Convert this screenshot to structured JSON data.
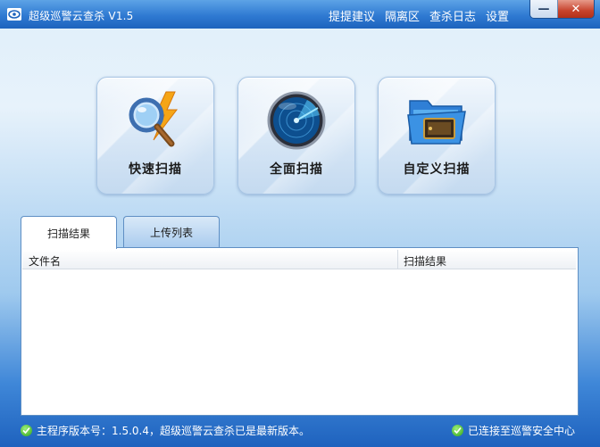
{
  "window": {
    "title": "超级巡警云查杀 V1.5",
    "links": [
      "提提建议",
      "隔离区",
      "查杀日志",
      "设置"
    ],
    "minimize_glyph": "—",
    "close_glyph": "✕"
  },
  "scan_buttons": {
    "quick": {
      "label": "快速扫描",
      "icon": "magnifier-lightning-icon"
    },
    "full": {
      "label": "全面扫描",
      "icon": "radar-icon"
    },
    "custom": {
      "label": "自定义扫描",
      "icon": "folder-icon"
    }
  },
  "tabs": [
    "扫描结果",
    "上传列表"
  ],
  "table": {
    "columns": [
      "文件名",
      "扫描结果"
    ],
    "rows": []
  },
  "status": {
    "left": "主程序版本号：1.5.0.4，超级巡警云查杀已是最新版本。",
    "right": "已连接至巡警安全中心"
  },
  "colors": {
    "title_bar": "#2f7ad2",
    "accent": "#1e62be",
    "ok_green": "#2ea21a"
  }
}
